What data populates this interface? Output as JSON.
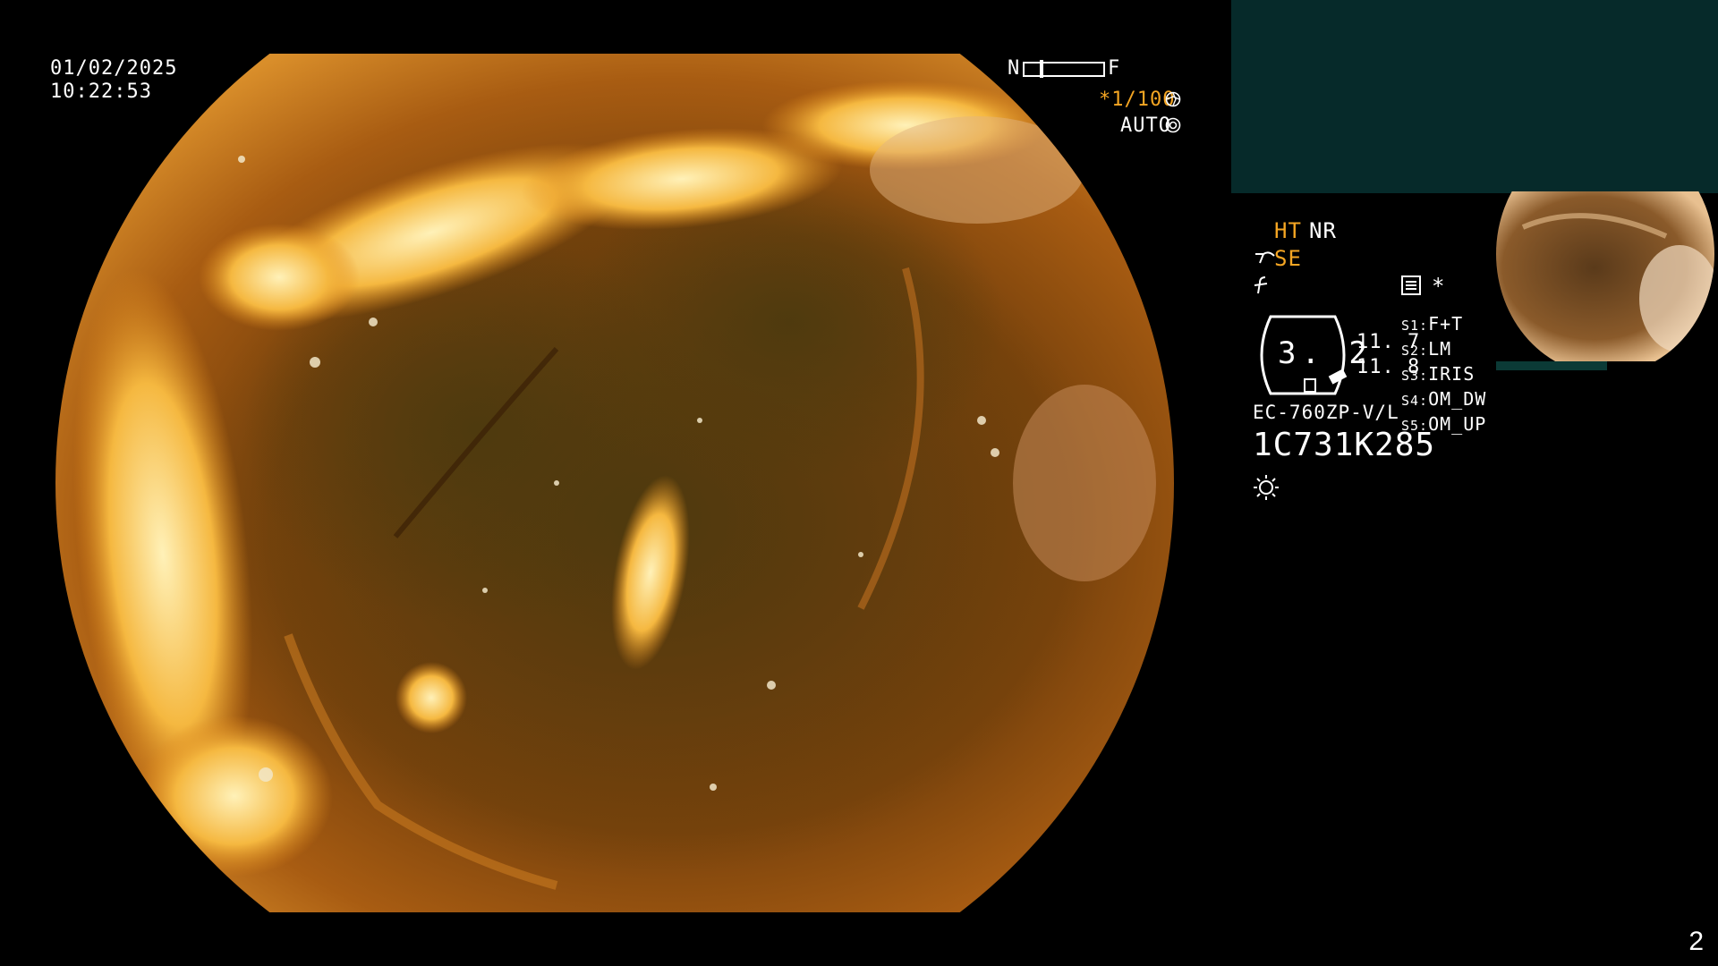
{
  "overlay": {
    "date": "01/02/2025",
    "time": "10:22:53",
    "focus_near": "N",
    "focus_far": "F",
    "shutter": "*1/100",
    "iris_mode": "AUTO",
    "page_number": "2"
  },
  "settings": {
    "ht": "HT",
    "nr": "NR",
    "se": "SE",
    "star": "*",
    "zoom_value": "3. 2",
    "value_upper": "11. 7",
    "value_lower": "11. 8",
    "scope_model": "EC-760ZP-V/L",
    "serial": "1C731K285",
    "switches": [
      {
        "key": "S1:",
        "value": "F+T"
      },
      {
        "key": "S2:",
        "value": "LM"
      },
      {
        "key": "S3:",
        "value": "IRIS"
      },
      {
        "key": "S4:",
        "value": "OM_DW"
      },
      {
        "key": "S5:",
        "value": "OM_UP"
      }
    ]
  },
  "colors": {
    "accent_orange": "#f5a623",
    "panel_teal": "#062a2a",
    "background": "#000000"
  },
  "icons": {
    "shutter": "aperture-icon",
    "iris": "iris-icon",
    "se": "se-mode-icon",
    "freeze": "freeze-icon",
    "image_mode": "image-mode-icon",
    "light": "sun-icon"
  }
}
